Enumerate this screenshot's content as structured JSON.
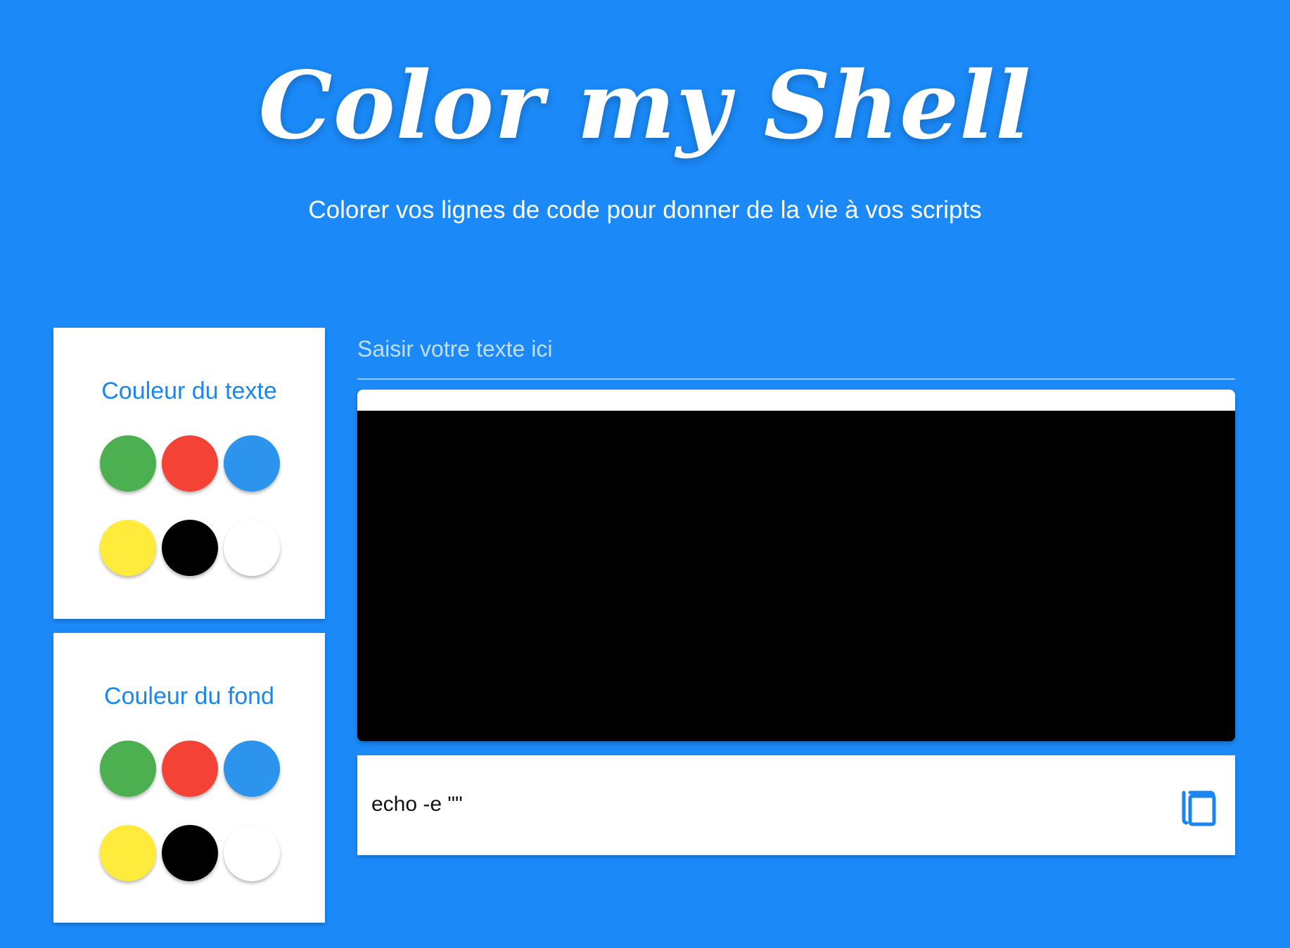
{
  "header": {
    "title": "Color my Shell",
    "subtitle": "Colorer vos lignes de code pour donner de la vie à vos scripts"
  },
  "panels": {
    "text_color": {
      "title": "Couleur du texte",
      "swatches": [
        {
          "name": "green",
          "color": "#4caf50"
        },
        {
          "name": "red",
          "color": "#f44336"
        },
        {
          "name": "blue",
          "color": "#2d94ee"
        },
        {
          "name": "yellow",
          "color": "#ffeb3b"
        },
        {
          "name": "black",
          "color": "#000000"
        },
        {
          "name": "white",
          "color": "#ffffff"
        }
      ]
    },
    "background_color": {
      "title": "Couleur du fond",
      "swatches": [
        {
          "name": "green",
          "color": "#4caf50"
        },
        {
          "name": "red",
          "color": "#f44336"
        },
        {
          "name": "blue",
          "color": "#2d94ee"
        },
        {
          "name": "yellow",
          "color": "#ffeb3b"
        },
        {
          "name": "black",
          "color": "#000000"
        },
        {
          "name": "white",
          "color": "#ffffff"
        }
      ]
    }
  },
  "input": {
    "placeholder": "Saisir votre texte ici",
    "value": ""
  },
  "terminal": {
    "bar_color": "#ffffff",
    "screen_color": "#000000"
  },
  "command": {
    "text": "echo -e \"\"",
    "copy_icon": "copy-icon"
  },
  "colors": {
    "page_background": "#1b8af8",
    "accent": "#1a86f2"
  }
}
